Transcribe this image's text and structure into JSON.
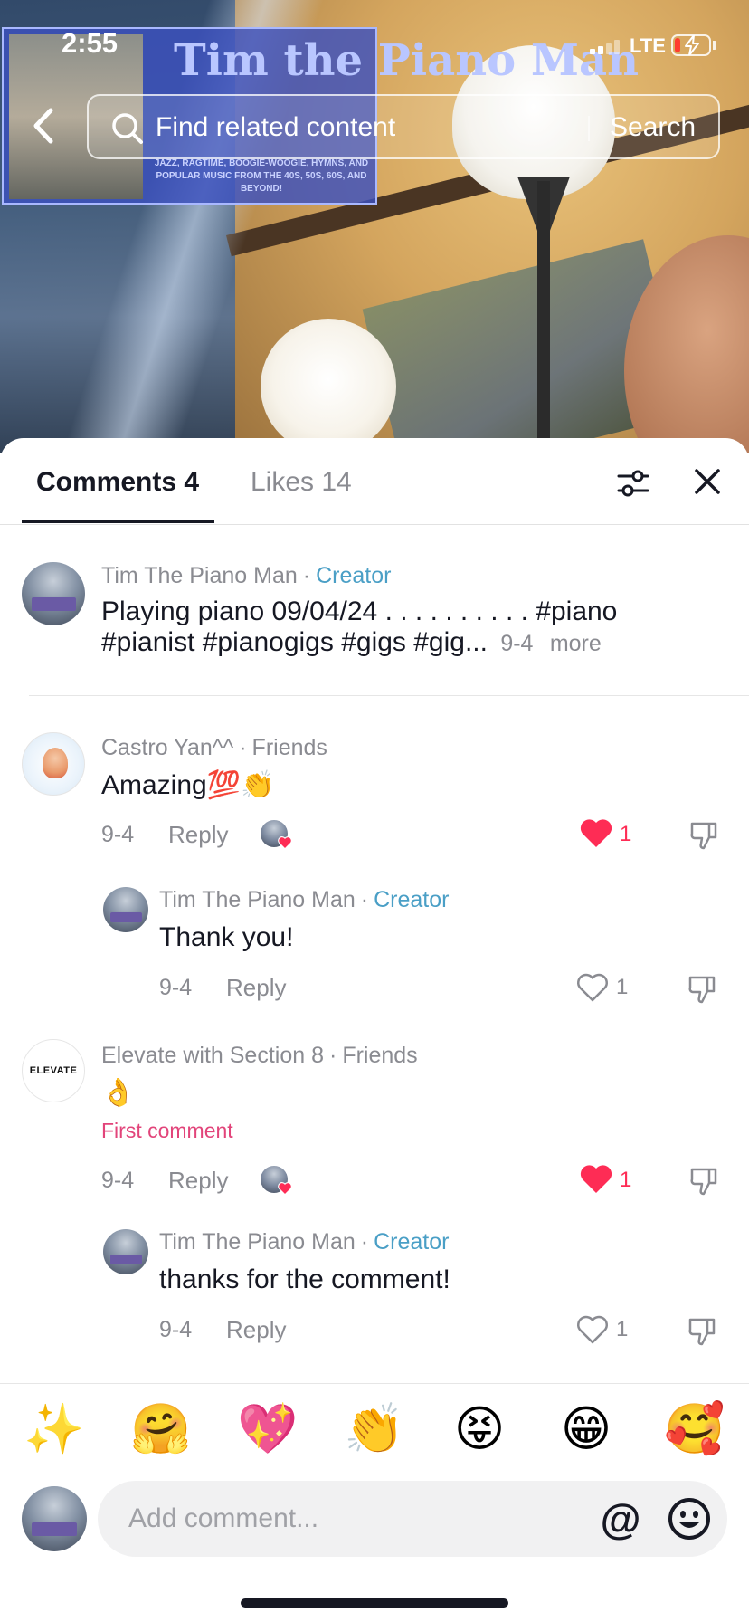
{
  "status_bar": {
    "time": "2:55",
    "network": "LTE"
  },
  "video": {
    "banner_title": "Tim the Piano Man",
    "banner_subtitle": "JAZZ, RAGTIME, BOOGIE-WOOGIE, HYMNS, AND POPULAR MUSIC FROM THE 40S, 50S, 60S, AND BEYOND!"
  },
  "search": {
    "placeholder": "Find related content",
    "button_label": "Search"
  },
  "tabs": {
    "comments": "Comments 4",
    "likes": "Likes 14"
  },
  "post": {
    "author": "Tim The Piano Man",
    "badge": "Creator",
    "line1": "Playing piano 09/04/24 . . . . . . . . . . #piano",
    "line2": "#pianist #pianogigs #gigs #gig...",
    "date": "9-4",
    "more": "more"
  },
  "comments": [
    {
      "author": "Castro Yan^^",
      "relation": "Friends",
      "text": "Amazing💯👏",
      "date": "9-4",
      "reply": "Reply",
      "likes": "1",
      "liked": true,
      "replies": [
        {
          "author": "Tim The Piano Man",
          "badge": "Creator",
          "text": "Thank you!",
          "date": "9-4",
          "reply": "Reply",
          "likes": "1"
        }
      ]
    },
    {
      "author": "Elevate with Section 8",
      "relation": "Friends",
      "avatar_text": "ELEVATE",
      "text": "👌",
      "tag": "First comment",
      "date": "9-4",
      "reply": "Reply",
      "likes": "1",
      "liked": true,
      "replies": [
        {
          "author": "Tim The Piano Man",
          "badge": "Creator",
          "text": "thanks for the comment!",
          "date": "9-4",
          "reply": "Reply",
          "likes": "1"
        }
      ]
    }
  ],
  "quick_emojis": [
    "✨",
    "🤗",
    "💖",
    "👏",
    "😝",
    "😁",
    "🥰"
  ],
  "compose": {
    "placeholder": "Add comment...",
    "at_label": "@"
  },
  "colors": {
    "accent_like": "#fe2c55",
    "creator_badge": "#4a9fc6",
    "first_comment": "#e2447a"
  }
}
